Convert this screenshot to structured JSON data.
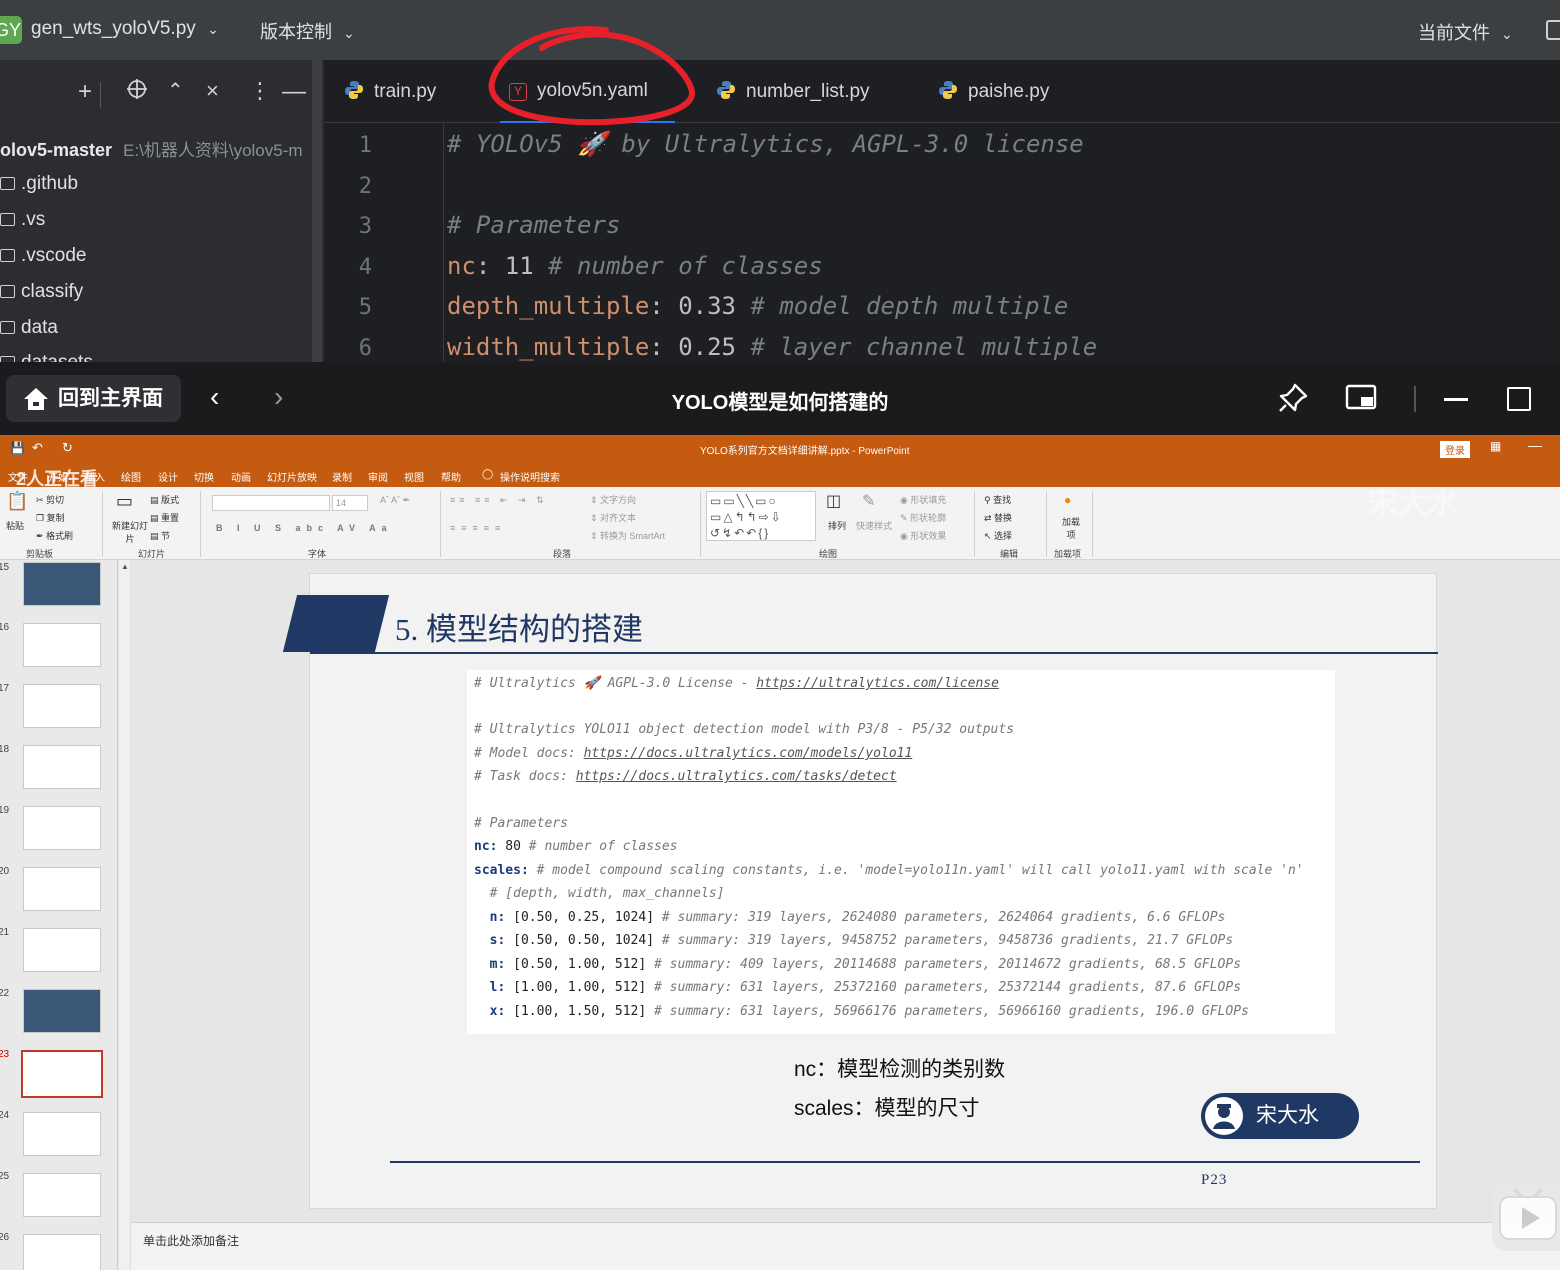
{
  "ide": {
    "badge": "GY",
    "project_file": "gen_wts_yoloV5.py",
    "vcs": "版本控制",
    "current_file": "当前文件",
    "tree": {
      "root_name": "olov5-master",
      "root_path": "E:\\机器人资料\\yolov5-m",
      "items": [
        ".github",
        ".vs",
        ".vscode",
        "classify",
        "data",
        "datasets"
      ]
    },
    "tabs": [
      "train.py",
      "yolov5n.yaml",
      "number_list.py",
      "paishe.py"
    ],
    "line_numbers": [
      "1",
      "2",
      "3",
      "4",
      "5",
      "6"
    ],
    "code": {
      "l1": "# YOLOv5 🚀 by Ultralytics, AGPL-3.0 license",
      "l3": "# Parameters",
      "l4_key": "nc",
      "l4_val": " 11 ",
      "l4_com": "# number of classes",
      "l5_key": "depth_multiple",
      "l5_val": " 0.33 ",
      "l5_com": "# model depth multiple",
      "l6_key": "width_multiple",
      "l6_val": " 0.25 ",
      "l6_com": "# layer channel multiple"
    }
  },
  "video": {
    "home": "回到主界面",
    "title": "YOLO模型是如何搭建的",
    "viewers": "2人正在看"
  },
  "ppt": {
    "window_title": "YOLO系列官方文档详细讲解.pptx  -  PowerPoint",
    "login": "登录",
    "menus": [
      "文件",
      "开始",
      "插入",
      "绘图",
      "设计",
      "切换",
      "动画",
      "幻灯片放映",
      "录制",
      "审阅",
      "视图",
      "帮助",
      "操作说明搜索"
    ],
    "ribbon": {
      "paste": "粘贴",
      "cut": "剪切",
      "copy": "复制",
      "format_painter": "格式刷",
      "new_slide": "新建幻灯片",
      "layout": "版式",
      "reset": "重置",
      "section": "节",
      "font_size": "14",
      "text_dir": "文字方向",
      "align_text": "对齐文本",
      "smartart": "转换为 SmartArt",
      "arrange": "排列",
      "quick_styles": "快速样式",
      "shape_fill": "形状填充",
      "shape_outline": "形状轮廓",
      "shape_effects": "形状效果",
      "find": "查找",
      "replace": "替换",
      "select": "选择",
      "addins": "加载项",
      "groups": [
        "剪贴板",
        "幻灯片",
        "字体",
        "段落",
        "绘图",
        "编辑",
        "加载项"
      ]
    },
    "thumbs": [
      "15",
      "16",
      "17",
      "18",
      "19",
      "20",
      "21",
      "22",
      "23",
      "24",
      "25",
      "26"
    ],
    "notes_placeholder": "单击此处添加备注",
    "watermark": "宋大水"
  },
  "slide": {
    "title": "5.  模型结构的搭建",
    "code": {
      "l1a": "# Ultralytics 🚀 AGPL-3.0 License - ",
      "l1b": "https://ultralytics.com/license",
      "l2": "# Ultralytics YOLO11 object detection model with P3/8 - P5/32 outputs",
      "l3a": "# Model docs: ",
      "l3b": "https://docs.ultralytics.com/models/yolo11",
      "l4a": "# Task docs: ",
      "l4b": "https://docs.ultralytics.com/tasks/detect",
      "l5": "# Parameters",
      "l6k": "nc:",
      "l6v": " 80 ",
      "l6c": "# number of classes",
      "l7k": "scales:",
      "l7c": " # model compound scaling constants, i.e. 'model=yolo11n.yaml' will call yolo11.yaml with scale 'n'",
      "l8": "  # [depth, width, max_channels]",
      "rows": [
        {
          "k": "  n:",
          "v": " [0.50, 0.25, 1024] ",
          "c": "# summary: 319 layers, 2624080 parameters, 2624064 gradients, 6.6 GFLOPs"
        },
        {
          "k": "  s:",
          "v": " [0.50, 0.50, 1024] ",
          "c": "# summary: 319 layers, 9458752 parameters, 9458736 gradients, 21.7 GFLOPs"
        },
        {
          "k": "  m:",
          "v": " [0.50, 1.00, 512] ",
          "c": "# summary: 409 layers, 20114688 parameters, 20114672 gradients, 68.5 GFLOPs"
        },
        {
          "k": "  l:",
          "v": " [1.00, 1.00, 512] ",
          "c": "# summary: 631 layers, 25372160 parameters, 25372144 gradients, 87.6 GFLOPs"
        },
        {
          "k": "  x:",
          "v": " [1.00, 1.50, 512] ",
          "c": "# summary: 631 layers, 56966176 parameters, 56966160 gradients, 196.0 GFLOPs"
        }
      ]
    },
    "note1": "nc：模型检测的类别数",
    "note2": "scales：模型的尺寸",
    "author": "宋大水",
    "page": "P23"
  },
  "colors": {
    "ide_bg": "#1e1f22",
    "ppt_accent": "#c55a11",
    "slide_navy": "#1f3864",
    "annotation_red": "#e8202a"
  }
}
